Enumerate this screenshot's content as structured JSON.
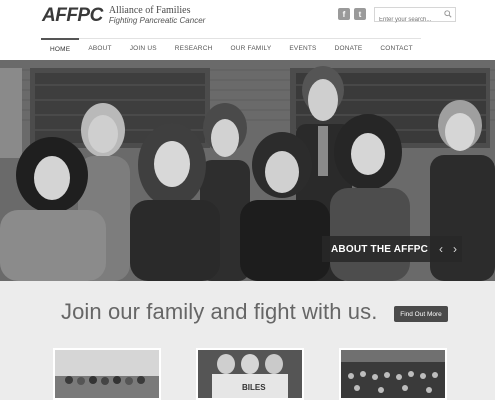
{
  "header": {
    "logo_mark": "AFFPC",
    "logo_line1": "Alliance of Families",
    "logo_line2": "Fighting Pancreatic Cancer",
    "social": [
      {
        "name": "facebook-icon",
        "glyph": "f"
      },
      {
        "name": "twitter-icon",
        "glyph": "t"
      }
    ],
    "search_placeholder": "Enter your search..."
  },
  "nav": {
    "items": [
      {
        "label": "HOME",
        "active": true
      },
      {
        "label": "ABOUT",
        "active": false
      },
      {
        "label": "JOIN US",
        "active": false
      },
      {
        "label": "RESEARCH",
        "active": false
      },
      {
        "label": "OUR FAMILY",
        "active": false
      },
      {
        "label": "EVENTS",
        "active": false
      },
      {
        "label": "DONATE",
        "active": false
      },
      {
        "label": "CONTACT",
        "active": false
      }
    ]
  },
  "hero": {
    "caption": "ABOUT THE AFFPC",
    "prev_glyph": "‹",
    "next_glyph": "›"
  },
  "section": {
    "tagline": "Join our family and fight with us.",
    "cta_label": "Find Out More"
  },
  "thumbnails": [
    {
      "name": "thumbnail-outdoor-group"
    },
    {
      "name": "thumbnail-family-event",
      "sign_text": "BILES"
    },
    {
      "name": "thumbnail-crowd-event"
    }
  ]
}
